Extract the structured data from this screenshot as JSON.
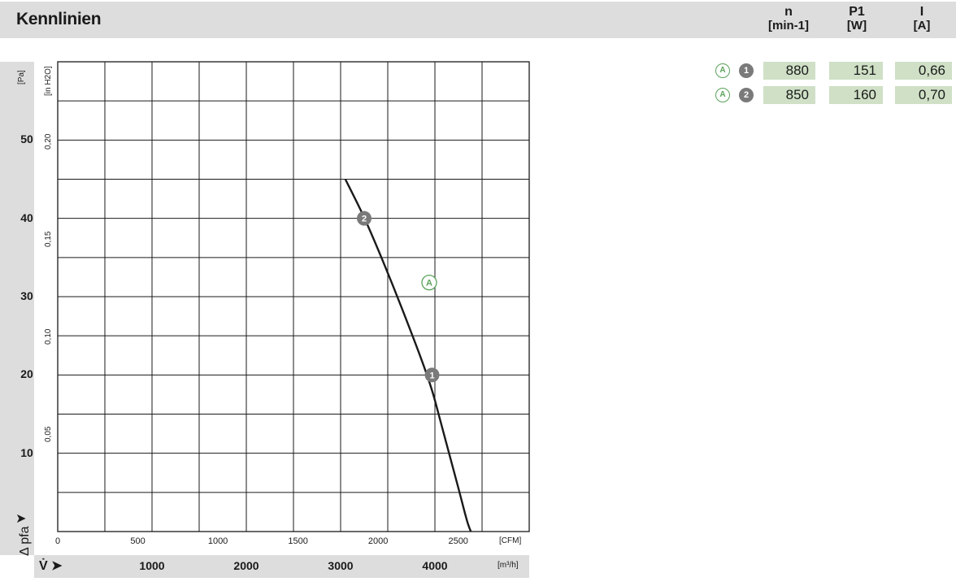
{
  "header": {
    "title": "Kennlinien",
    "columns": [
      {
        "symbol": "n",
        "unit": "[min-1]"
      },
      {
        "symbol": "P1",
        "unit": "[W]"
      },
      {
        "symbol": "I",
        "unit": "[A]"
      }
    ]
  },
  "table": {
    "rows": [
      {
        "curve": "A",
        "point": "1",
        "n": "880",
        "p1": "151",
        "i": "0,66"
      },
      {
        "curve": "A",
        "point": "2",
        "n": "850",
        "p1": "160",
        "i": "0,70"
      }
    ]
  },
  "chart_data": {
    "type": "line",
    "xlabel": "V̇",
    "ylabel": "Δ pfa",
    "y_unit": "[Pa]",
    "y2_unit": "[in H2O]",
    "x_unit_cfm": "[CFM]",
    "x_unit_m3h": "[m³/h]",
    "xlim_m3h": [
      0,
      5000
    ],
    "ylim_pa": [
      0,
      60
    ],
    "grid": true,
    "y_ticks": [
      "10",
      "20",
      "30",
      "40",
      "50"
    ],
    "y_tick_values": [
      10,
      20,
      30,
      40,
      50
    ],
    "y2_ticks": [
      "0,05",
      "0,10",
      "0,15",
      "0,20"
    ],
    "y2_tick_values": [
      0.05,
      0.1,
      0.15,
      0.2
    ],
    "x_ticks_cfm": [
      "0",
      "500",
      "1000",
      "1500",
      "2000",
      "2500"
    ],
    "x_tick_values_cfm": [
      0,
      500,
      1000,
      1500,
      2000,
      2500
    ],
    "x_ticks_m3h": [
      "1000",
      "2000",
      "3000",
      "4000"
    ],
    "x_tick_values_m3h": [
      1000,
      2000,
      3000,
      4000
    ],
    "series": [
      {
        "name": "A",
        "color": "#1a1a1a",
        "x_m3h": [
          3050,
          3250,
          3450,
          3650,
          3850,
          3970,
          4050,
          4150,
          4250,
          4350,
          4420
        ],
        "y_pa": [
          45.0,
          40.1,
          34.5,
          28.5,
          22.2,
          18.0,
          14.5,
          10.0,
          5.5,
          1.0,
          -1.0
        ]
      }
    ],
    "points": [
      {
        "label": "1",
        "x_m3h": 3970,
        "y_pa": 20
      },
      {
        "label": "2",
        "x_m3h": 3250,
        "y_pa": 40
      }
    ],
    "curve_label": {
      "text": "A",
      "x_m3h": 3750,
      "y_pa": 23.5
    }
  }
}
